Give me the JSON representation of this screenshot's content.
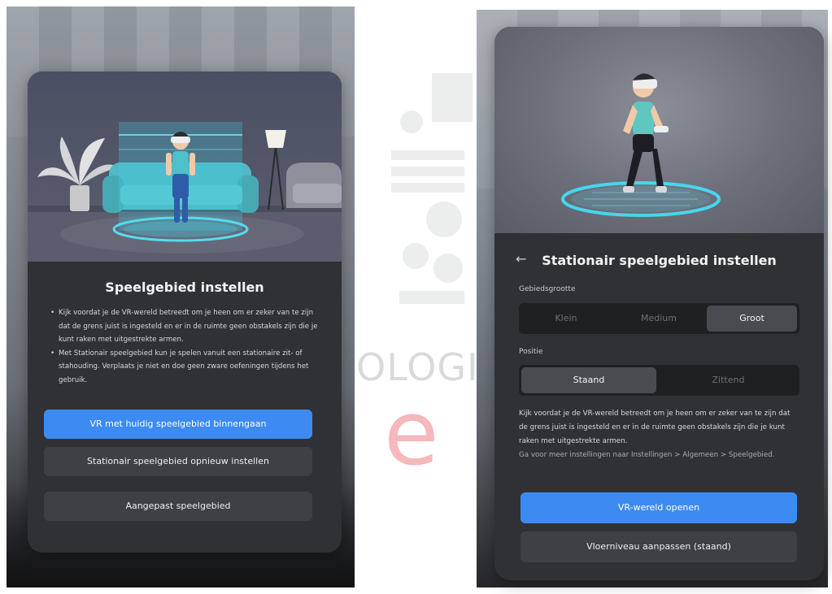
{
  "left_panel": {
    "title": "Speelgebied instellen",
    "bullets": [
      "Kijk voordat je de VR-wereld betreedt om je heen om er zeker van te zijn dat de grens juist is ingesteld en er in de ruimte geen obstakels zijn die je kunt raken met uitgestrekte armen.",
      "Met Stationair speelgebied kun je spelen vanuit een stationaire zit- of stahouding. Verplaats je niet en doe geen zware oefeningen tijdens het gebruik."
    ],
    "buttons": {
      "enter": "VR met huidig speelgebied binnengaan",
      "reset": "Stationair speelgebied opnieuw instellen",
      "custom": "Aangepast speelgebied"
    }
  },
  "right_panel": {
    "back_glyph": "←",
    "title": "Stationair speelgebied instellen",
    "size_label": "Gebiedsgrootte",
    "size_options": [
      "Klein",
      "Medium",
      "Groot"
    ],
    "size_selected": "Groot",
    "position_label": "Positie",
    "position_options": [
      "Staand",
      "Zittend"
    ],
    "position_selected": "Staand",
    "description": "Kijk voordat je de VR-wereld betreedt om je heen om er zeker van te zijn dat de grens juist is ingesteld en er in de ruimte geen obstakels zijn die je kunt raken met uitgestrekte armen.",
    "description_sub": "Ga voor meer instellingen naar Instellingen > Algemeen > Speelgebied.",
    "buttons": {
      "open": "VR-wereld openen",
      "floor": "Vloerniveau aanpassen (staand)"
    }
  },
  "watermark": {
    "text": "OLOGI",
    "letter": "e"
  },
  "colors": {
    "panel": "#303134",
    "primary": "#3d8bf2",
    "secondary_button": "#3f4044",
    "boundary": "#3fd0e6"
  }
}
